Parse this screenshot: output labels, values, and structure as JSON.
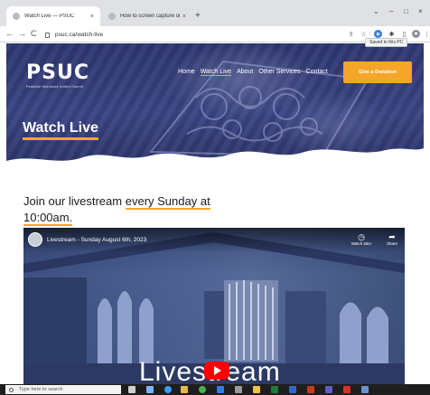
{
  "browser": {
    "tabs": [
      {
        "title": "Watch Live — PSUC",
        "close": "×"
      },
      {
        "title": "How to screen capture on wind",
        "close": "×"
      }
    ],
    "new_tab": "+",
    "window_controls": [
      "⌄",
      "–",
      "□",
      "×"
    ],
    "url": "psuc.ca/watch-live",
    "nav_back": "←",
    "nav_forward": "→",
    "nav_reload": "C",
    "tooltip": "Saved to this PC"
  },
  "site": {
    "logo": "PSUC",
    "logo_subtitle": "Parkdale Sherwood United Church",
    "nav": [
      "Home",
      "Watch Live",
      "About",
      "Other Services",
      "Contact"
    ],
    "donate_label": "Give a Donation",
    "page_title": "Watch Live",
    "join_text_1": "Join our livestream",
    "join_text_2": "every Sunday at",
    "join_text_3": "10:00am."
  },
  "video": {
    "title": "Livestream - Sunday August 6th, 2023",
    "watch_later": "Watch later",
    "share": "Share",
    "overlay_text": "Livestream",
    "brand_color": "#ff0000"
  },
  "taskbar": {
    "search_placeholder": "Type here to search"
  },
  "colors": {
    "accent": "#f4a62a",
    "hero": "#323b74"
  }
}
